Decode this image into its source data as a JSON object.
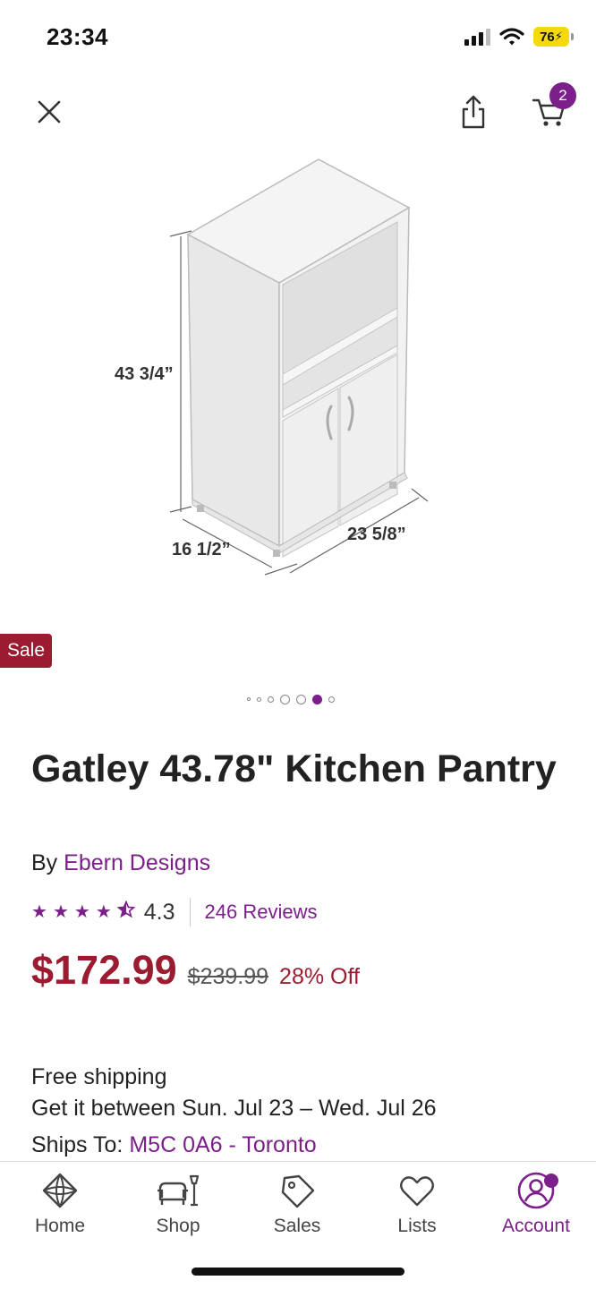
{
  "status_bar": {
    "time": "23:34",
    "battery": "76"
  },
  "header": {
    "cart_count": "2"
  },
  "product_image": {
    "height_label": "43 3/4”",
    "depth_label": "16 1/2”",
    "width_label": "23 5/8”"
  },
  "badge": {
    "label": "Sale"
  },
  "carousel": {
    "total": 7,
    "active_index": 5
  },
  "product": {
    "title": "Gatley 43.78\" Kitchen Pantry",
    "by_label": "By",
    "brand": "Ebern Designs",
    "rating": "4.3",
    "reviews": "246 Reviews",
    "price": "$172.99",
    "original_price": "$239.99",
    "discount": "28% Off"
  },
  "shipping": {
    "free_label": "Free shipping",
    "delivery": "Get it between Sun. Jul 23 – Wed. Jul 26",
    "ships_to_label": "Ships To:",
    "ships_to_value": "M5C 0A6 - Toronto"
  },
  "tabs": [
    {
      "label": "Home",
      "icon": "home-icon"
    },
    {
      "label": "Shop",
      "icon": "furniture-icon"
    },
    {
      "label": "Sales",
      "icon": "tag-icon"
    },
    {
      "label": "Lists",
      "icon": "heart-icon"
    },
    {
      "label": "Account",
      "icon": "account-icon"
    }
  ],
  "colors": {
    "accent": "#7b1f8a",
    "sale": "#9b1c31"
  }
}
